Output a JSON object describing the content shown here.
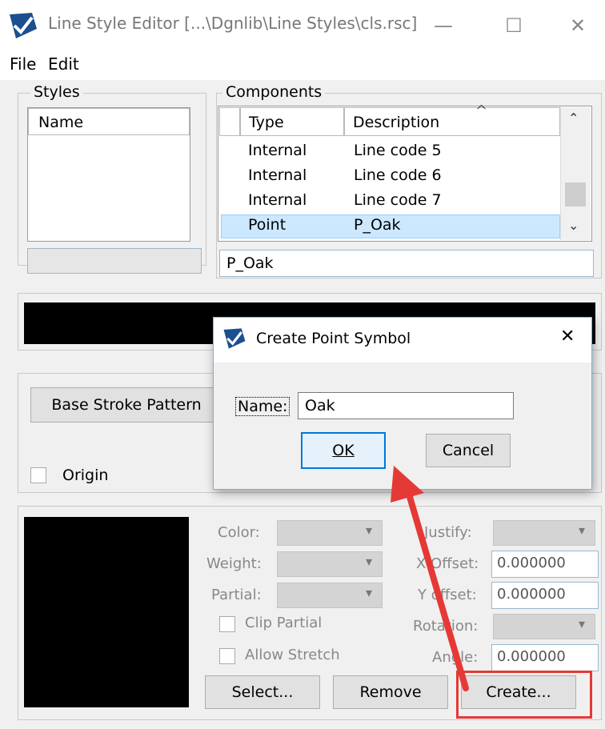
{
  "window": {
    "title": "Line Style Editor [...\\Dgnlib\\Line Styles\\cls.rsc]",
    "minimize": "—",
    "maximize": "☐",
    "close": "✕"
  },
  "menu": {
    "file": "File",
    "edit": "Edit"
  },
  "styles": {
    "label": "Styles",
    "column": "Name",
    "name_value": ""
  },
  "components": {
    "label": "Components",
    "columns": {
      "type": "Type",
      "description": "Description"
    },
    "rows": [
      {
        "type": "Internal",
        "description": "Line code 5"
      },
      {
        "type": "Internal",
        "description": "Line code 6"
      },
      {
        "type": "Internal",
        "description": "Line code 7"
      },
      {
        "type": "Point",
        "description": "P_Oak"
      }
    ],
    "selected_value": "P_Oak"
  },
  "stroke": {
    "base_button": "Base Stroke Pattern",
    "origin": "Origin"
  },
  "symbol_props": {
    "color": "Color:",
    "weight": "Weight:",
    "partial": "Partial:",
    "clip_partial": "Clip Partial",
    "allow_stretch": "Allow Stretch",
    "justify": "Justify:",
    "x_offset": "X Offset:",
    "y_offset": "Y offset:",
    "rotation": "Rotation:",
    "angle": "Angle:",
    "x_offset_value": "0.000000",
    "y_offset_value": "0.000000",
    "angle_value": "0.000000"
  },
  "buttons": {
    "select": "Select...",
    "remove": "Remove",
    "create": "Create..."
  },
  "dialog": {
    "title": "Create Point Symbol",
    "close": "✕",
    "name_label": "Name:",
    "name_value": "Oak",
    "ok": "OK",
    "cancel": "Cancel"
  },
  "colors": {
    "accent": "#0078d7",
    "highlight_row": "#cce8ff",
    "annotation": "#e53935"
  }
}
